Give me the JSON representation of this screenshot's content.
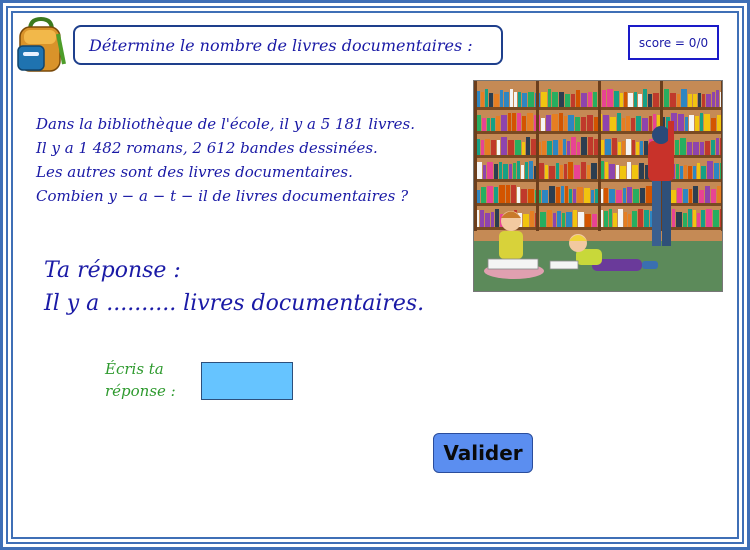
{
  "header": {
    "title": "Détermine le nombre de livres documentaires :",
    "score": "score = 0/0"
  },
  "problem": {
    "lines": [
      "Dans la bibliothèque de l'école, il y a 5 181 livres.",
      "Il y a 1 482 romans, 2 612 bandes dessinées.",
      "Les autres sont des livres documentaires.",
      "Combien y − a − t − il de livres documentaires ?"
    ]
  },
  "answer": {
    "label": "Ta réponse :",
    "sentence": "Il y a .......... livres documentaires."
  },
  "form": {
    "input_label_line1": "Écris ta",
    "input_label_line2": "réponse :",
    "input_value": "",
    "submit_label": "Valider"
  },
  "colors": {
    "text_blue": "#1a1aa6",
    "frame_blue": "#3f6fb6",
    "label_green": "#2e9a2e",
    "input_fill": "#66c4ff",
    "button_fill": "#5b8ef0"
  },
  "icons": {
    "backpack": "backpack-icon",
    "illustration": "library-illustration"
  }
}
